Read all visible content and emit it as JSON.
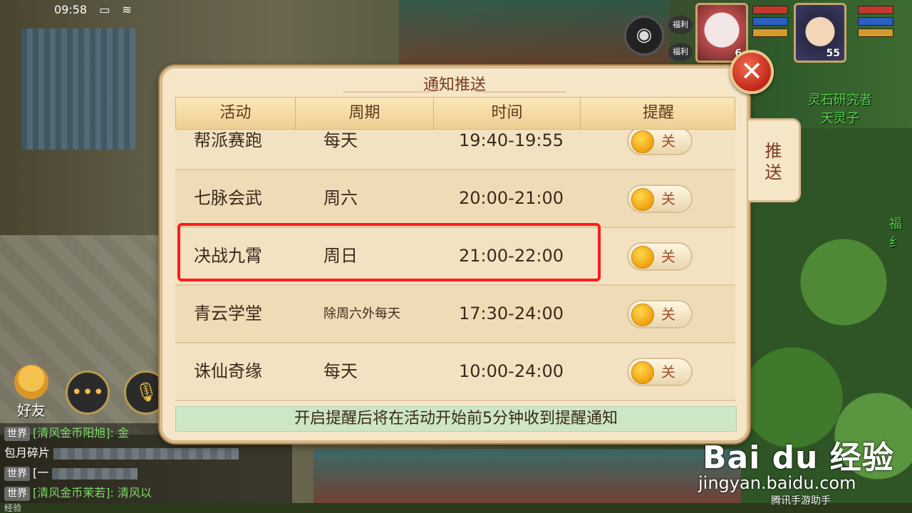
{
  "status_bar": {
    "time": "09:58",
    "battery_icon": "battery-icon",
    "wifi_icon": "wifi-icon"
  },
  "hud": {
    "camera_icon": "camera-icon",
    "fuli_labels": [
      "福利",
      "福利"
    ],
    "portrait_levels": [
      "6",
      "55"
    ],
    "npc_name_line1": "灵石研究者",
    "npc_name_line2": "天灵子",
    "edge_text": "福纟"
  },
  "dialog": {
    "title": "通知推送",
    "close_label": "✕",
    "side_tab_label": "推送",
    "columns": [
      "活动",
      "周期",
      "时间",
      "提醒"
    ],
    "rows": [
      {
        "activity": "帮派赛跑",
        "period": "每天",
        "time": "19:40-19:55",
        "toggle": "关"
      },
      {
        "activity": "七脉会武",
        "period": "周六",
        "time": "20:00-21:00",
        "toggle": "关"
      },
      {
        "activity": "决战九霄",
        "period": "周日",
        "time": "21:00-22:00",
        "toggle": "关"
      },
      {
        "activity": "青云学堂",
        "period": "除周六外每天",
        "time": "17:30-24:00",
        "toggle": "关"
      },
      {
        "activity": "诛仙奇缘",
        "period": "每天",
        "time": "10:00-24:00",
        "toggle": "关"
      }
    ],
    "footer_note": "开启提醒后将在活动开始前5分钟收到提醒通知"
  },
  "bottom_left": {
    "friend_label": "好友",
    "chat_icon": "chat-bubble-icon",
    "mic_icon": "microphone-icon",
    "chat": [
      {
        "channel": "世界",
        "text": "[清风金币阳旭]: 金"
      },
      {
        "channel": "",
        "text": "包月碎片"
      },
      {
        "channel": "世界",
        "text": "[一"
      },
      {
        "channel": "世界",
        "text": "[清风金币茉若]: 清风以"
      }
    ],
    "exp_label": "经验"
  },
  "watermark": {
    "logo": "Bai du 经验",
    "url": "jingyan.baidu.com",
    "helper": "腾讯手游助手"
  }
}
